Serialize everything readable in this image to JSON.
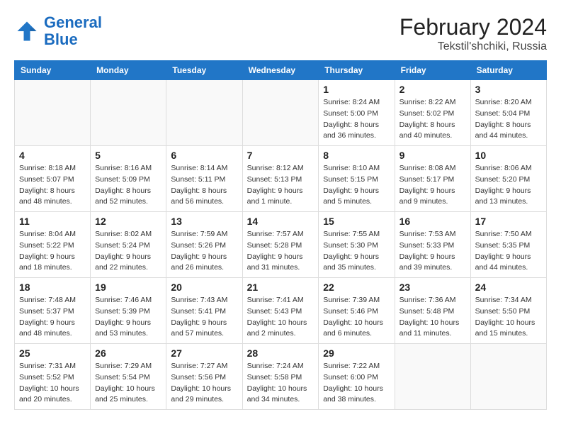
{
  "header": {
    "logo_line1": "General",
    "logo_line2": "Blue",
    "month_year": "February 2024",
    "location": "Tekstil'shchiki, Russia"
  },
  "weekdays": [
    "Sunday",
    "Monday",
    "Tuesday",
    "Wednesday",
    "Thursday",
    "Friday",
    "Saturday"
  ],
  "weeks": [
    [
      {
        "day": "",
        "info": ""
      },
      {
        "day": "",
        "info": ""
      },
      {
        "day": "",
        "info": ""
      },
      {
        "day": "",
        "info": ""
      },
      {
        "day": "1",
        "info": "Sunrise: 8:24 AM\nSunset: 5:00 PM\nDaylight: 8 hours\nand 36 minutes."
      },
      {
        "day": "2",
        "info": "Sunrise: 8:22 AM\nSunset: 5:02 PM\nDaylight: 8 hours\nand 40 minutes."
      },
      {
        "day": "3",
        "info": "Sunrise: 8:20 AM\nSunset: 5:04 PM\nDaylight: 8 hours\nand 44 minutes."
      }
    ],
    [
      {
        "day": "4",
        "info": "Sunrise: 8:18 AM\nSunset: 5:07 PM\nDaylight: 8 hours\nand 48 minutes."
      },
      {
        "day": "5",
        "info": "Sunrise: 8:16 AM\nSunset: 5:09 PM\nDaylight: 8 hours\nand 52 minutes."
      },
      {
        "day": "6",
        "info": "Sunrise: 8:14 AM\nSunset: 5:11 PM\nDaylight: 8 hours\nand 56 minutes."
      },
      {
        "day": "7",
        "info": "Sunrise: 8:12 AM\nSunset: 5:13 PM\nDaylight: 9 hours\nand 1 minute."
      },
      {
        "day": "8",
        "info": "Sunrise: 8:10 AM\nSunset: 5:15 PM\nDaylight: 9 hours\nand 5 minutes."
      },
      {
        "day": "9",
        "info": "Sunrise: 8:08 AM\nSunset: 5:17 PM\nDaylight: 9 hours\nand 9 minutes."
      },
      {
        "day": "10",
        "info": "Sunrise: 8:06 AM\nSunset: 5:20 PM\nDaylight: 9 hours\nand 13 minutes."
      }
    ],
    [
      {
        "day": "11",
        "info": "Sunrise: 8:04 AM\nSunset: 5:22 PM\nDaylight: 9 hours\nand 18 minutes."
      },
      {
        "day": "12",
        "info": "Sunrise: 8:02 AM\nSunset: 5:24 PM\nDaylight: 9 hours\nand 22 minutes."
      },
      {
        "day": "13",
        "info": "Sunrise: 7:59 AM\nSunset: 5:26 PM\nDaylight: 9 hours\nand 26 minutes."
      },
      {
        "day": "14",
        "info": "Sunrise: 7:57 AM\nSunset: 5:28 PM\nDaylight: 9 hours\nand 31 minutes."
      },
      {
        "day": "15",
        "info": "Sunrise: 7:55 AM\nSunset: 5:30 PM\nDaylight: 9 hours\nand 35 minutes."
      },
      {
        "day": "16",
        "info": "Sunrise: 7:53 AM\nSunset: 5:33 PM\nDaylight: 9 hours\nand 39 minutes."
      },
      {
        "day": "17",
        "info": "Sunrise: 7:50 AM\nSunset: 5:35 PM\nDaylight: 9 hours\nand 44 minutes."
      }
    ],
    [
      {
        "day": "18",
        "info": "Sunrise: 7:48 AM\nSunset: 5:37 PM\nDaylight: 9 hours\nand 48 minutes."
      },
      {
        "day": "19",
        "info": "Sunrise: 7:46 AM\nSunset: 5:39 PM\nDaylight: 9 hours\nand 53 minutes."
      },
      {
        "day": "20",
        "info": "Sunrise: 7:43 AM\nSunset: 5:41 PM\nDaylight: 9 hours\nand 57 minutes."
      },
      {
        "day": "21",
        "info": "Sunrise: 7:41 AM\nSunset: 5:43 PM\nDaylight: 10 hours\nand 2 minutes."
      },
      {
        "day": "22",
        "info": "Sunrise: 7:39 AM\nSunset: 5:46 PM\nDaylight: 10 hours\nand 6 minutes."
      },
      {
        "day": "23",
        "info": "Sunrise: 7:36 AM\nSunset: 5:48 PM\nDaylight: 10 hours\nand 11 minutes."
      },
      {
        "day": "24",
        "info": "Sunrise: 7:34 AM\nSunset: 5:50 PM\nDaylight: 10 hours\nand 15 minutes."
      }
    ],
    [
      {
        "day": "25",
        "info": "Sunrise: 7:31 AM\nSunset: 5:52 PM\nDaylight: 10 hours\nand 20 minutes."
      },
      {
        "day": "26",
        "info": "Sunrise: 7:29 AM\nSunset: 5:54 PM\nDaylight: 10 hours\nand 25 minutes."
      },
      {
        "day": "27",
        "info": "Sunrise: 7:27 AM\nSunset: 5:56 PM\nDaylight: 10 hours\nand 29 minutes."
      },
      {
        "day": "28",
        "info": "Sunrise: 7:24 AM\nSunset: 5:58 PM\nDaylight: 10 hours\nand 34 minutes."
      },
      {
        "day": "29",
        "info": "Sunrise: 7:22 AM\nSunset: 6:00 PM\nDaylight: 10 hours\nand 38 minutes."
      },
      {
        "day": "",
        "info": ""
      },
      {
        "day": "",
        "info": ""
      }
    ]
  ]
}
